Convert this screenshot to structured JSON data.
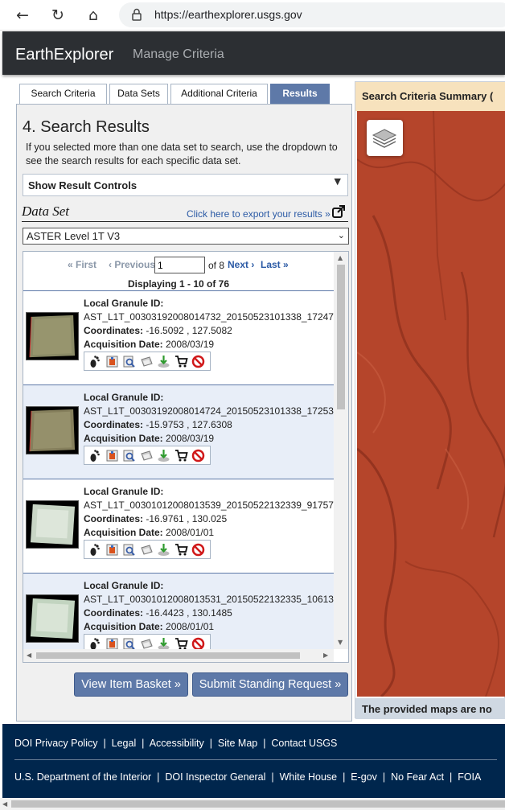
{
  "browser": {
    "url": "https://earthexplorer.usgs.gov"
  },
  "header": {
    "title": "EarthExplorer",
    "subtitle": "Manage Criteria"
  },
  "tabs": [
    {
      "label": "Search Criteria"
    },
    {
      "label": "Data Sets"
    },
    {
      "label": "Additional Criteria"
    },
    {
      "label": "Results",
      "active": true
    }
  ],
  "results": {
    "heading": "4. Search Results",
    "description": "If you selected more than one data set to search, use the dropdown to see the search results for each specific data set.",
    "controls_label": "Show Result Controls",
    "dataset_label": "Data Set",
    "export_link": "Click here to export your results »",
    "dataset_value": "ASTER Level 1T V3",
    "pager": {
      "first": "« First",
      "previous": "‹ Previous",
      "page": "1",
      "of": "of 8",
      "next": "Next ›",
      "last": "Last »"
    },
    "displaying": "Displaying 1 - 10 of 76",
    "items": [
      {
        "id_label": "Local Granule ID:",
        "id": "AST_L1T_00303192008014732_20150523101338_17247",
        "coord_label": "Coordinates:",
        "coords": "-16.5092 , 127.5082",
        "date_label": "Acquisition Date:",
        "date": "2008/03/19"
      },
      {
        "id_label": "Local Granule ID:",
        "id": "AST_L1T_00303192008014724_20150523101338_17253",
        "coord_label": "Coordinates:",
        "coords": "-15.9753 , 127.6308",
        "date_label": "Acquisition Date:",
        "date": "2008/03/19"
      },
      {
        "id_label": "Local Granule ID:",
        "id": "AST_L1T_00301012008013539_20150522132339_91757",
        "coord_label": "Coordinates:",
        "coords": "-16.9761 , 130.025",
        "date_label": "Acquisition Date:",
        "date": "2008/01/01"
      },
      {
        "id_label": "Local Granule ID:",
        "id": "AST_L1T_00301012008013531_20150522132335_10613",
        "coord_label": "Coordinates:",
        "coords": "-16.4423 , 130.1485",
        "date_label": "Acquisition Date:",
        "date": "2008/01/01"
      }
    ],
    "tool_icons": [
      "footprint-icon",
      "overlay-icon",
      "show-metadata-icon",
      "compare-icon",
      "download-icon",
      "cart-icon",
      "exclude-icon"
    ],
    "basket_button": "View Item Basket »",
    "standing_button": "Submit Standing Request »"
  },
  "map": {
    "header": "Search Criteria Summary (",
    "footer": "The provided maps are no",
    "colors": {
      "terrain": "#b7442a"
    }
  },
  "footer": {
    "row1": [
      "DOI Privacy Policy",
      "Legal",
      "Accessibility",
      "Site Map",
      "Contact USGS"
    ],
    "row2": [
      "U.S. Department of the Interior",
      "DOI Inspector General",
      "White House",
      "E-gov",
      "No Fear Act",
      "FOIA"
    ]
  }
}
